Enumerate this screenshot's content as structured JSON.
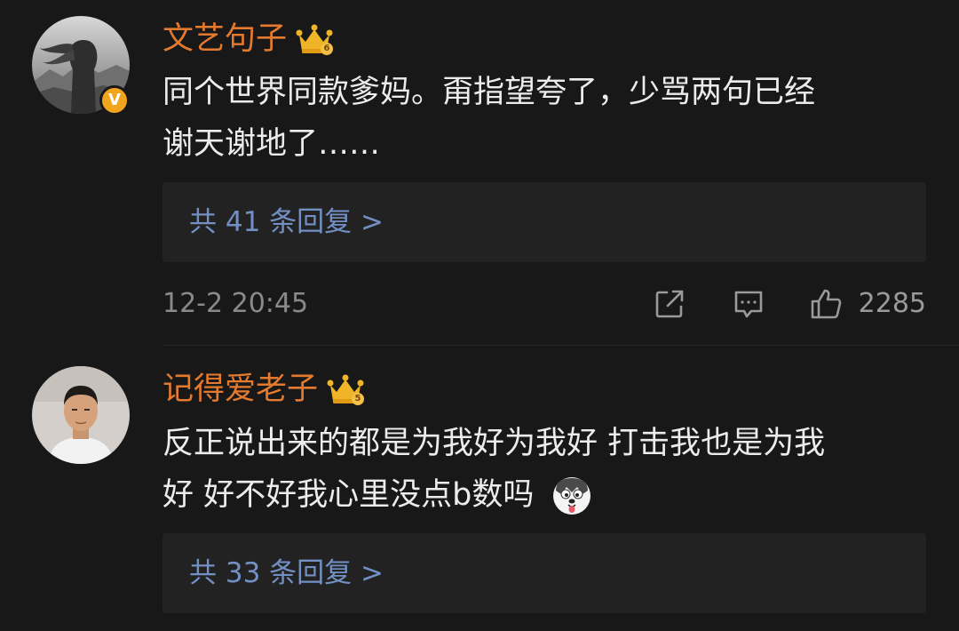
{
  "comments": [
    {
      "username": "文艺句子",
      "level": "6",
      "verified_badge": "V",
      "text_lines": [
        "同个世界同款爹妈。甭指望夸了，少骂两句已经",
        "谢天谢地了……"
      ],
      "replies_label": "共 41 条回复 >",
      "timestamp": "12-2 20:45",
      "likes": "2285",
      "icons": [
        "share-icon",
        "comment-icon",
        "like-icon"
      ]
    },
    {
      "username": "记得爱老子",
      "level": "5",
      "text_lines": [
        "反正说出来的都是为我好为我好 打击我也是为我",
        "好 好不好我心里没点b数吗"
      ],
      "emoji": "husky-emoji",
      "replies_label": "共 33 条回复 >"
    }
  ],
  "colors": {
    "background": "#181818",
    "username": "#e47a2e",
    "reply_link": "#7390c4",
    "crown": "#f0b429",
    "verified_badge": "#f0a51c"
  }
}
